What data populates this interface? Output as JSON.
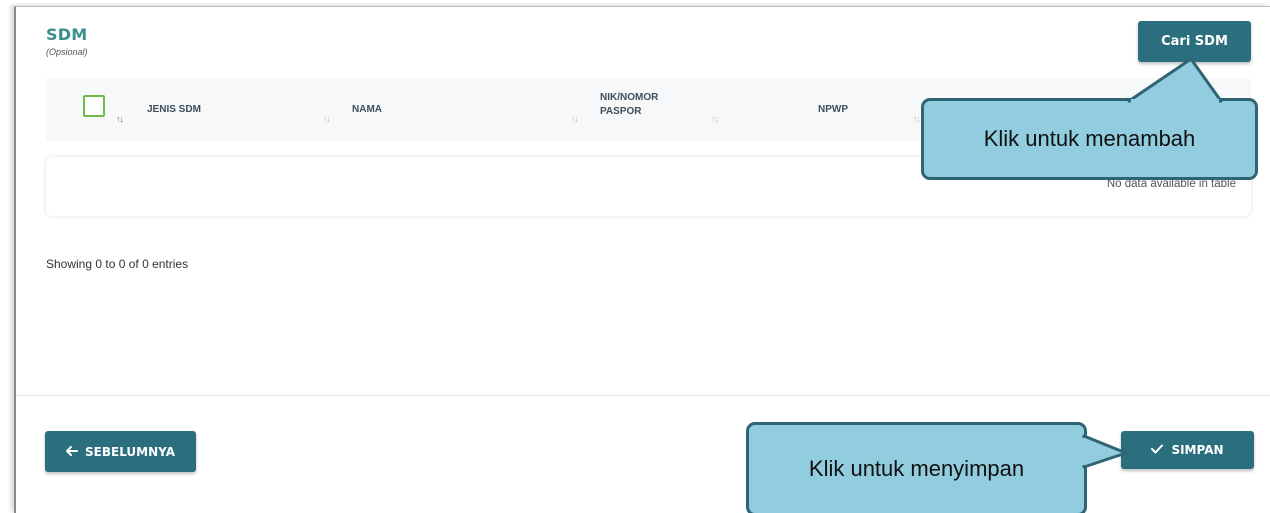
{
  "section": {
    "title": "SDM",
    "subtitle": "(Opsional)",
    "search_button": "Cari SDM"
  },
  "table": {
    "columns": [
      "JENIS SDM",
      "NAMA",
      "NIK/NOMOR",
      "PASPOR",
      "NPWP"
    ],
    "empty_message": "No data available in table"
  },
  "info": {
    "showing": "Showing 0 to 0 of 0 entries"
  },
  "footer": {
    "prev_label": "SEBELUMNYA",
    "save_label": "SIMPAN",
    "prev_icon": "arrow-left-icon",
    "save_icon": "check-icon"
  },
  "callouts": {
    "add": "Klik untuk menambah",
    "save": "Klik untuk menyimpan"
  },
  "colors": {
    "primary": "#2b6f7f",
    "title": "#3a8f8e",
    "callout_fill": "#92cddf",
    "callout_border": "#2f6474",
    "checkbox": "#6dbb4a"
  }
}
